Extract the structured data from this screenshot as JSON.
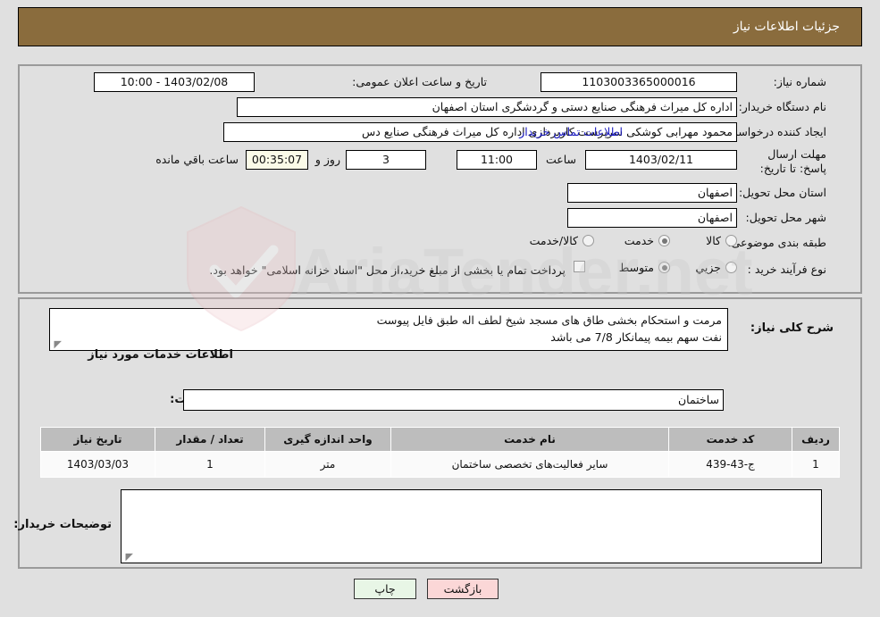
{
  "header": {
    "title": "جزئیات اطلاعات نیاز"
  },
  "form": {
    "need_number_label": "شماره نیاز:",
    "need_number_value": "1103003365000016",
    "public_announce_label": "تاریخ و ساعت اعلان عمومی:",
    "public_announce_value": "1403/02/08 - 10:00",
    "buyer_org_label": "نام دستگاه خریدار:",
    "buyer_org_value": "اداره کل میراث فرهنگی  صنایع دستی و گردشگری استان اصفهان",
    "creator_label": "ایجاد کننده درخواست:",
    "creator_value": "محمود مهرابی کوشکی سرپرست کاربردازی اداره کل میراث فرهنگی  صنایع دس",
    "contact_link": "اطلاعات تماس خریدار",
    "deadline_label": "مهلت ارسال پاسخ: تا تاریخ:",
    "deadline_date": "1403/02/11",
    "deadline_time_label": "ساعت",
    "deadline_time": "11:00",
    "remaining_days": "3",
    "remaining_days_label": "روز و",
    "remaining_clock": "00:35:07",
    "remaining_clock_label": "ساعت باقي مانده",
    "province_label": "استان محل تحویل:",
    "province_value": "اصفهان",
    "city_label": "شهر محل تحویل:",
    "city_value": "اصفهان",
    "category_label": "طبقه بندی موضوعی:",
    "category_options": [
      {
        "label": "کالا",
        "selected": false
      },
      {
        "label": "خدمت",
        "selected": true
      },
      {
        "label": "کالا/خدمت",
        "selected": false
      }
    ],
    "process_label": "نوع فرآیند خرید :",
    "process_options": [
      {
        "label": "جزیي",
        "selected": false
      },
      {
        "label": "متوسط",
        "selected": true
      }
    ],
    "treasury_checkbox_checked": false,
    "treasury_text": "پرداخت تمام یا بخشی از مبلغ خرید،از محل \"اسناد خزانه اسلامی\" خواهد بود."
  },
  "need_summary": {
    "label": "شرح کلی نیاز:",
    "line1": "مرمت و استحکام بخشی طاق های مسجد شیخ لطف اله طبق فایل پیوست",
    "line2": "نفت سهم بیمه پیمانکار 7/8 می باشد"
  },
  "services_section": {
    "title": "اطلاعات خدمات مورد نیاز",
    "group_label": "گروه خدمت:",
    "group_value": "ساختمان"
  },
  "table": {
    "columns": [
      "ردیف",
      "کد خدمت",
      "نام خدمت",
      "واحد اندازه گیری",
      "تعداد / مقدار",
      "تاریخ نیاز"
    ],
    "rows": [
      {
        "row": "1",
        "code": "ج-43-439",
        "name": "سایر فعالیت‌های تخصصی ساختمان",
        "unit": "متر",
        "qty": "1",
        "date": "1403/03/03"
      }
    ]
  },
  "buyer_notes": {
    "label": "توضیحات خریدار:",
    "value": ""
  },
  "footer": {
    "print_label": "چاپ",
    "back_label": "بازگشت"
  },
  "watermark": {
    "text": "AriaTender.net"
  },
  "colors": {
    "header_brown": "#8a6c3d",
    "page_bg": "#e0e0e0",
    "link_blue": "#1a1ac0",
    "print_green": "#e8f6e6",
    "back_pink": "#fbd7d7"
  }
}
